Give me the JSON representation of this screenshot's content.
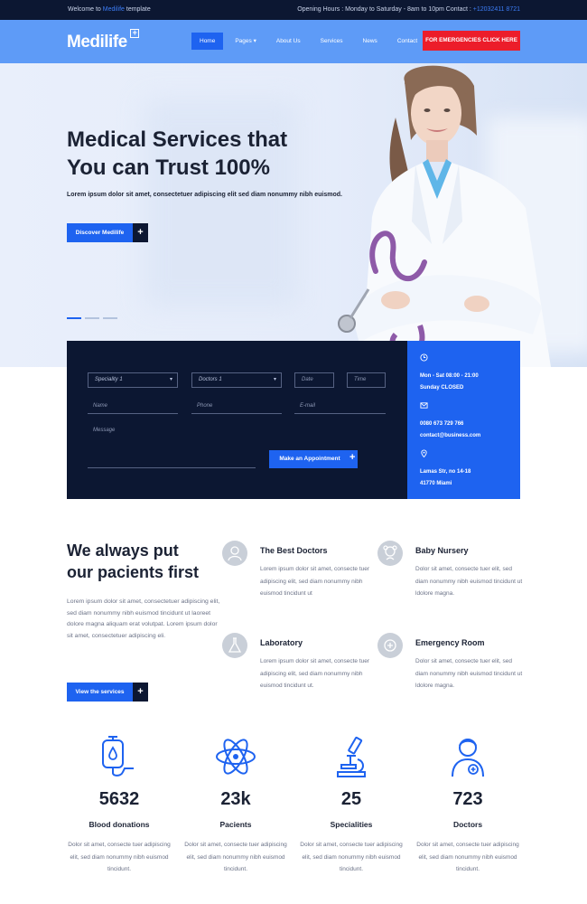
{
  "topbar": {
    "welcome_prefix": "Welcome to",
    "welcome_brand": "Medilife",
    "welcome_suffix": "template",
    "hours": "Opening Hours : Monday to Saturday - 8am to 10pm Contact :",
    "phone": "+12032411 8721"
  },
  "header": {
    "logo": "Medilife",
    "nav": [
      "Home",
      "Pages",
      "About Us",
      "Services",
      "News",
      "Contact"
    ],
    "emergency_label": "FOR EMERGENCIES CLICK HERE"
  },
  "hero": {
    "title": "Medical Services that\nYou can Trust 100%",
    "subtitle": "Lorem ipsum dolor sit amet, consectetuer adipiscing elit sed diam nonummy nibh euismod.",
    "button_label": "Discover Medilife",
    "plus": "+"
  },
  "appointment": {
    "speciality_value": "Speciality 1",
    "doctors_value": "Doctors 1",
    "date_placeholder": "Date",
    "time_placeholder": "Time",
    "name_placeholder": "Name",
    "phone_placeholder": "Phone",
    "email_placeholder": "E-mail",
    "message_placeholder": "Message",
    "submit_label": "Make an Appointment",
    "plus": "+"
  },
  "info": {
    "hours": "Mon - Sat 08:00 - 21:00\nSunday CLOSED",
    "contact": "0080 673 729 766\ncontact@business.com",
    "address": "Lamas Str, no 14-18\n41770 Miami"
  },
  "welcome": {
    "title": "We always put\nour pacients first",
    "text": "Lorem ipsum dolor sit amet, consectetuer adipiscing elit, sed diam nonummy nibh euismod tincidunt ut laoreet dolore magna aliquam erat volutpat. Lorem ipsum dolor sit amet, consectetuer adipiscing eli.",
    "button_label": "View the services",
    "plus": "+"
  },
  "features": [
    {
      "title": "The Best Doctors",
      "text": "Lorem ipsum dolor sit amet, consecte tuer adipiscing elit, sed diam nonummy nibh euismod tincidunt ut",
      "icon": "doctor-icon"
    },
    {
      "title": "Baby Nursery",
      "text": "Dolor sit amet, consecte tuer elit, sed diam nonummy nibh euismod tincidunt ut ldolore magna.",
      "icon": "baby-icon"
    },
    {
      "title": "Laboratory",
      "text": "Lorem ipsum dolor sit amet, consecte tuer adipiscing elit, sed diam nonummy nibh euismod tincidunt ut.",
      "icon": "flask-icon"
    },
    {
      "title": "Emergency Room",
      "text": "Dolor sit amet, consecte tuer elit, sed diam nonummy nibh euismod tincidunt ut ldolore magna.",
      "icon": "emergency-icon"
    }
  ],
  "stats": [
    {
      "number": "5632",
      "label": "Blood donations",
      "text": "Dolor sit amet, consecte tuer adipiscing elit, sed diam nonummy nibh euismod tincidunt.",
      "icon": "blood-bag-icon"
    },
    {
      "number": "23k",
      "label": "Pacients",
      "text": "Dolor sit amet, consecte tuer adipiscing elit, sed diam nonummy nibh euismod tincidunt.",
      "icon": "atom-icon"
    },
    {
      "number": "25",
      "label": "Specialities",
      "text": "Dolor sit amet, consecte tuer adipiscing elit, sed diam nonummy nibh euismod tincidunt.",
      "icon": "microscope-icon"
    },
    {
      "number": "723",
      "label": "Doctors",
      "text": "Dolor sit amet, consecte tuer adipiscing elit, sed diam nonummy nibh euismod tincidunt.",
      "icon": "doctor-avatar-icon"
    }
  ],
  "colors": {
    "primary": "#1e63f0",
    "dark": "#0c1732",
    "emergency": "#ec1d2a",
    "header": "#5e9bf7"
  }
}
